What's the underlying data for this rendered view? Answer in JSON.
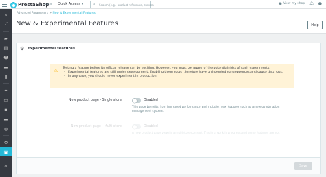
{
  "topbar": {
    "logo_text": "PrestaShop",
    "version": "8.0.0",
    "quick_access": "Quick Access",
    "search_placeholder": "Search (e.g.: product reference, custom",
    "view_shop": "View my shop"
  },
  "breadcrumb": {
    "parent": "Advanced Parameters",
    "separator": ">",
    "current": "New & Experimental Features"
  },
  "header": {
    "title": "New & Experimental Features",
    "help_label": "Help"
  },
  "panel": {
    "title": "Experimental features",
    "alert": {
      "intro": "Testing a feature before its official release can be exciting. However, you must be aware of the potential risks of such experiments:",
      "bullets": [
        "Experimental features are still under development. Enabling them could therefore have unintended consequences and cause data loss.",
        "In any case, you should never experiment in production."
      ]
    },
    "features": [
      {
        "label": "New product page - Single store",
        "state": "Disabled",
        "help": "This page benefits from increased performance and includes new features such as a new combination management system."
      },
      {
        "label": "New product page - Multi store",
        "state": "Disabled",
        "help": "A new product page view in a multistore context. This is a work in progress and some features are not"
      }
    ],
    "save_label": "Save"
  },
  "colors": {
    "accent": "#25b9d7",
    "sidebar": "#363a41",
    "warning": "#fab000",
    "warning_bg": "#fff3d7"
  }
}
